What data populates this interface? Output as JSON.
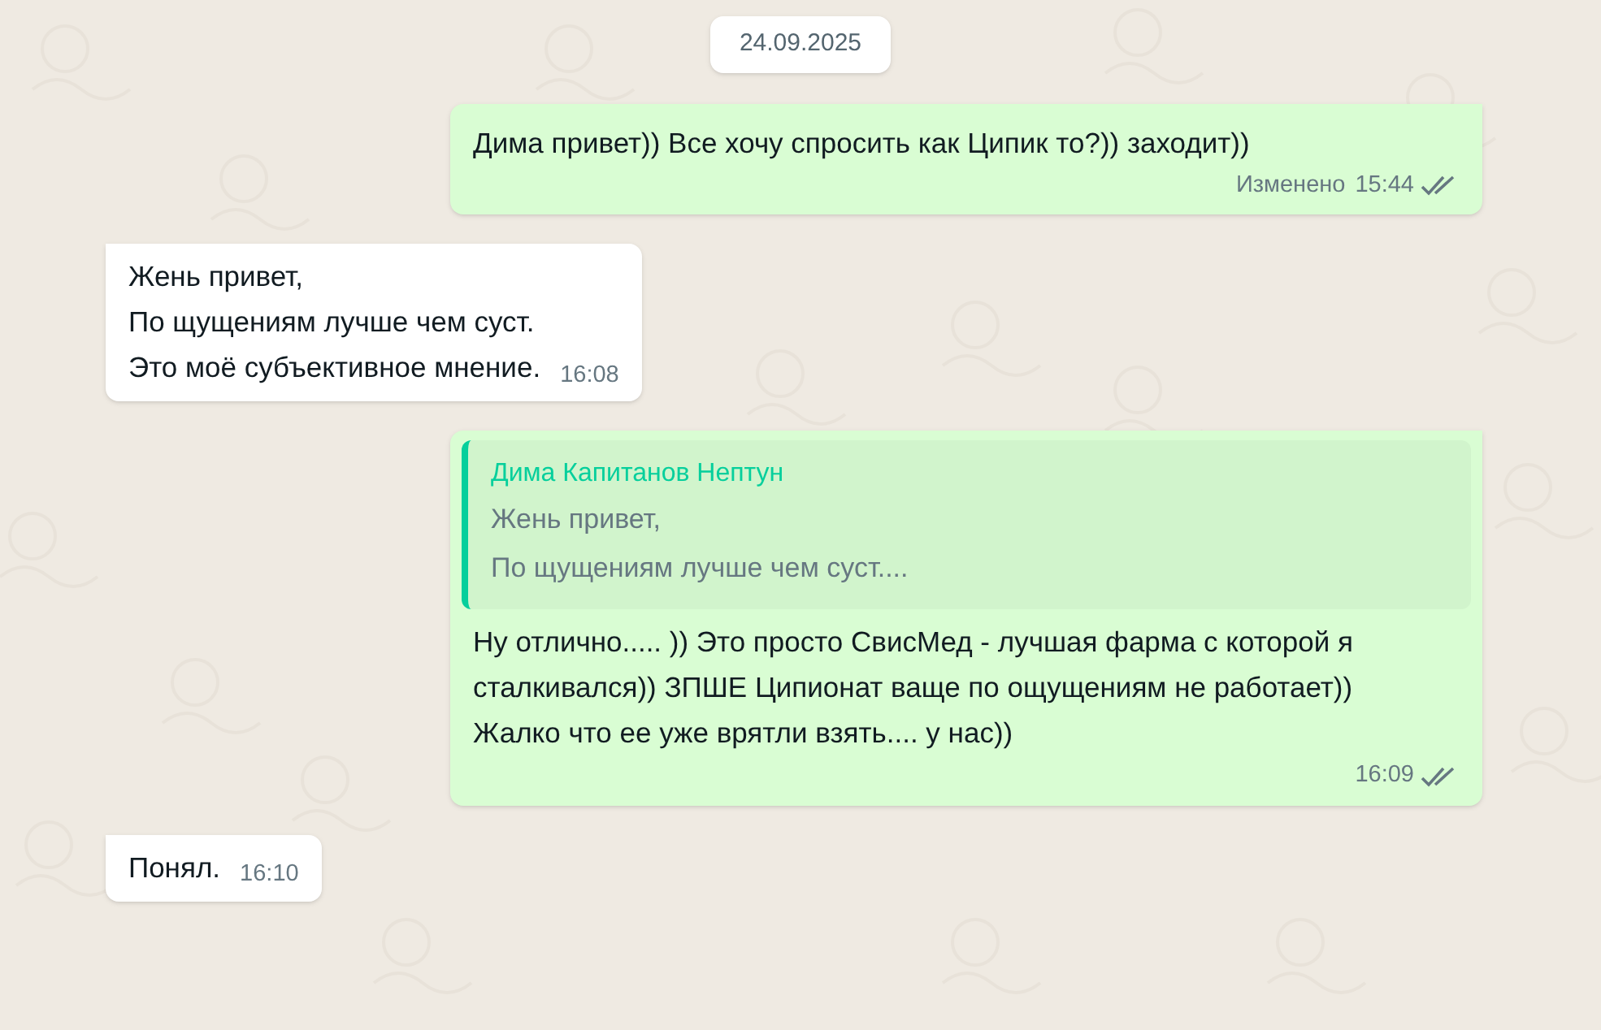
{
  "date_badge": "24.09.2025",
  "messages": [
    {
      "kind": "outgoing",
      "text": "Дима привет)) Все хочу спросить как Ципик то?)) заходит))",
      "edited_label": "Изменено",
      "time": "15:44",
      "delivered": true,
      "read": false
    },
    {
      "kind": "incoming",
      "text": "Жень привет,\nПо щущениям лучше чем суст.\nЭто моё субъективное мнение.",
      "time": "16:08"
    },
    {
      "kind": "outgoing",
      "quote": {
        "author": "Дима Капитанов Нептун",
        "text": "Жень привет,\nПо щущениям лучше чем суст...."
      },
      "text": "Ну отлично..... )) Это просто СвисМед - лучшая фарма с которой я сталкивался)) ЗПШЕ Ципионат ваще по ощущениям не работает))  Жалко что ее уже врятли взять.... у нас))",
      "time": "16:09",
      "delivered": true,
      "read": false
    },
    {
      "kind": "incoming",
      "text": "Понял.",
      "time": "16:10"
    }
  ]
}
